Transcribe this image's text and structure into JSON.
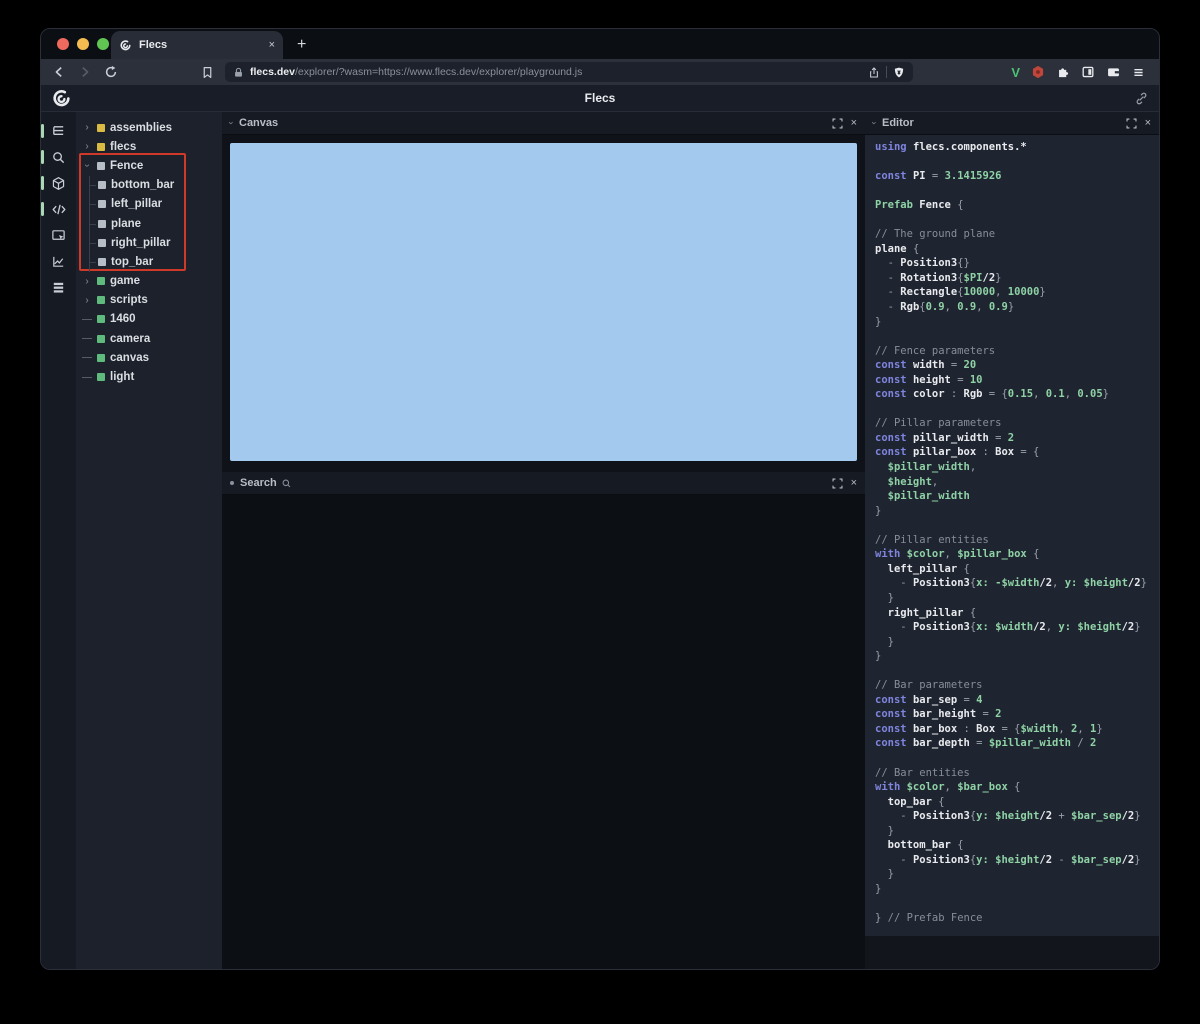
{
  "browser": {
    "tab_title": "Flecs",
    "new_tab_label": "+",
    "close_tab_label": "×",
    "url_domain": "flecs.dev",
    "url_path": "/explorer/?wasm=https://www.flecs.dev/explorer/playground.js",
    "traffic_colors": {
      "close": "#ee6a5f",
      "minimize": "#f5bd4f",
      "zoom": "#61c554"
    },
    "extension_v_label": "V"
  },
  "header": {
    "title": "Flecs"
  },
  "panels": {
    "canvas": {
      "title": "Canvas",
      "close_label": "×",
      "background_color": "#a3c9ee"
    },
    "search": {
      "title": "Search",
      "close_label": "×"
    },
    "editor": {
      "title": "Editor",
      "close_label": "×"
    }
  },
  "sidebar": {
    "items": [
      {
        "name": "entity-tree",
        "active": true
      },
      {
        "name": "query-search",
        "active": true
      },
      {
        "name": "canvas-3d",
        "active": true
      },
      {
        "name": "script-editor",
        "active": true
      },
      {
        "name": "inspector",
        "active": false
      },
      {
        "name": "statistics",
        "active": false
      },
      {
        "name": "logs",
        "active": false
      }
    ],
    "active_color": "#a9d9b4"
  },
  "tree": {
    "highlight_color": "#cf3a28",
    "icon_colors": {
      "yellow": "#d9bb43",
      "white": "#b8bec6",
      "green": "#5fba7d"
    },
    "items": [
      {
        "label": "assemblies",
        "icon": "yellow",
        "arrow": "collapsed",
        "child": false
      },
      {
        "label": "flecs",
        "icon": "yellow",
        "arrow": "collapsed",
        "child": false
      },
      {
        "label": "Fence",
        "icon": "white",
        "arrow": "expanded",
        "child": false
      },
      {
        "label": "bottom_bar",
        "icon": "white",
        "arrow": "none",
        "child": true
      },
      {
        "label": "left_pillar",
        "icon": "white",
        "arrow": "none",
        "child": true
      },
      {
        "label": "plane",
        "icon": "white",
        "arrow": "none",
        "child": true
      },
      {
        "label": "right_pillar",
        "icon": "white",
        "arrow": "none",
        "child": true
      },
      {
        "label": "top_bar",
        "icon": "white",
        "arrow": "none",
        "child": true
      },
      {
        "label": "game",
        "icon": "green",
        "arrow": "collapsed",
        "child": false
      },
      {
        "label": "scripts",
        "icon": "green",
        "arrow": "collapsed",
        "child": false
      },
      {
        "label": "1460",
        "icon": "green",
        "arrow": "leaf",
        "child": false
      },
      {
        "label": "camera",
        "icon": "green",
        "arrow": "leaf",
        "child": false
      },
      {
        "label": "canvas",
        "icon": "green",
        "arrow": "leaf",
        "child": false
      },
      {
        "label": "light",
        "icon": "green",
        "arrow": "leaf",
        "child": false
      }
    ]
  },
  "editor_code": {
    "token_colors": {
      "keyword": "#7e84de",
      "comment": "#878d99",
      "identifier": "#e8eaee",
      "value": "#8fd2a6",
      "punct": "#9aa1ab"
    },
    "lines": [
      [
        [
          "k",
          "using "
        ],
        [
          "i",
          "flecs.components.*"
        ]
      ],
      [],
      [
        [
          "k",
          "const "
        ],
        [
          "i",
          "PI"
        ],
        [
          "p",
          " = "
        ],
        [
          "g",
          "3.1415926"
        ]
      ],
      [],
      [
        [
          "g",
          "Prefab "
        ],
        [
          "i",
          "Fence "
        ],
        [
          "p",
          "{"
        ]
      ],
      [],
      [
        [
          "c",
          "// The ground plane"
        ]
      ],
      [
        [
          "i",
          "plane "
        ],
        [
          "p",
          "{"
        ]
      ],
      [
        [
          "p",
          "  - "
        ],
        [
          "i",
          "Position3"
        ],
        [
          "p",
          "{}"
        ]
      ],
      [
        [
          "p",
          "  - "
        ],
        [
          "i",
          "Rotation3"
        ],
        [
          "p",
          "{"
        ],
        [
          "g",
          "$PI"
        ],
        [
          "i",
          "/2"
        ],
        [
          "p",
          "}"
        ]
      ],
      [
        [
          "p",
          "  - "
        ],
        [
          "i",
          "Rectangle"
        ],
        [
          "p",
          "{"
        ],
        [
          "g",
          "10000"
        ],
        [
          "p",
          ", "
        ],
        [
          "g",
          "10000"
        ],
        [
          "p",
          "}"
        ]
      ],
      [
        [
          "p",
          "  - "
        ],
        [
          "i",
          "Rgb"
        ],
        [
          "p",
          "{"
        ],
        [
          "g",
          "0.9"
        ],
        [
          "p",
          ", "
        ],
        [
          "g",
          "0.9"
        ],
        [
          "p",
          ", "
        ],
        [
          "g",
          "0.9"
        ],
        [
          "p",
          "}"
        ]
      ],
      [
        [
          "p",
          "}"
        ]
      ],
      [],
      [
        [
          "c",
          "// Fence parameters"
        ]
      ],
      [
        [
          "k",
          "const "
        ],
        [
          "i",
          "width"
        ],
        [
          "p",
          " = "
        ],
        [
          "g",
          "20"
        ]
      ],
      [
        [
          "k",
          "const "
        ],
        [
          "i",
          "height"
        ],
        [
          "p",
          " = "
        ],
        [
          "g",
          "10"
        ]
      ],
      [
        [
          "k",
          "const "
        ],
        [
          "i",
          "color"
        ],
        [
          "p",
          " : "
        ],
        [
          "i",
          "Rgb"
        ],
        [
          "p",
          " = {"
        ],
        [
          "g",
          "0.15"
        ],
        [
          "p",
          ", "
        ],
        [
          "g",
          "0.1"
        ],
        [
          "p",
          ", "
        ],
        [
          "g",
          "0.05"
        ],
        [
          "p",
          "}"
        ]
      ],
      [],
      [
        [
          "c",
          "// Pillar parameters"
        ]
      ],
      [
        [
          "k",
          "const "
        ],
        [
          "i",
          "pillar_width"
        ],
        [
          "p",
          " = "
        ],
        [
          "g",
          "2"
        ]
      ],
      [
        [
          "k",
          "const "
        ],
        [
          "i",
          "pillar_box"
        ],
        [
          "p",
          " : "
        ],
        [
          "i",
          "Box"
        ],
        [
          "p",
          " = {"
        ]
      ],
      [
        [
          "g",
          "  $pillar_width"
        ],
        [
          "p",
          ","
        ]
      ],
      [
        [
          "g",
          "  $height"
        ],
        [
          "p",
          ","
        ]
      ],
      [
        [
          "g",
          "  $pillar_width"
        ]
      ],
      [
        [
          "p",
          "}"
        ]
      ],
      [],
      [
        [
          "c",
          "// Pillar entities"
        ]
      ],
      [
        [
          "k",
          "with "
        ],
        [
          "g",
          "$color"
        ],
        [
          "p",
          ", "
        ],
        [
          "g",
          "$pillar_box"
        ],
        [
          "p",
          " {"
        ]
      ],
      [
        [
          "i",
          "  left_pillar "
        ],
        [
          "p",
          "{"
        ]
      ],
      [
        [
          "p",
          "    - "
        ],
        [
          "i",
          "Position3"
        ],
        [
          "p",
          "{"
        ],
        [
          "g",
          "x: -$width"
        ],
        [
          "i",
          "/2"
        ],
        [
          "p",
          ", "
        ],
        [
          "g",
          "y: $height"
        ],
        [
          "i",
          "/2"
        ],
        [
          "p",
          "}"
        ]
      ],
      [
        [
          "p",
          "  }"
        ]
      ],
      [
        [
          "i",
          "  right_pillar "
        ],
        [
          "p",
          "{"
        ]
      ],
      [
        [
          "p",
          "    - "
        ],
        [
          "i",
          "Position3"
        ],
        [
          "p",
          "{"
        ],
        [
          "g",
          "x: $width"
        ],
        [
          "i",
          "/2"
        ],
        [
          "p",
          ", "
        ],
        [
          "g",
          "y: $height"
        ],
        [
          "i",
          "/2"
        ],
        [
          "p",
          "}"
        ]
      ],
      [
        [
          "p",
          "  }"
        ]
      ],
      [
        [
          "p",
          "}"
        ]
      ],
      [],
      [
        [
          "c",
          "// Bar parameters"
        ]
      ],
      [
        [
          "k",
          "const "
        ],
        [
          "i",
          "bar_sep"
        ],
        [
          "p",
          " = "
        ],
        [
          "g",
          "4"
        ]
      ],
      [
        [
          "k",
          "const "
        ],
        [
          "i",
          "bar_height"
        ],
        [
          "p",
          " = "
        ],
        [
          "g",
          "2"
        ]
      ],
      [
        [
          "k",
          "const "
        ],
        [
          "i",
          "bar_box"
        ],
        [
          "p",
          " : "
        ],
        [
          "i",
          "Box"
        ],
        [
          "p",
          " = {"
        ],
        [
          "g",
          "$width"
        ],
        [
          "p",
          ", "
        ],
        [
          "g",
          "2"
        ],
        [
          "p",
          ", "
        ],
        [
          "g",
          "1"
        ],
        [
          "p",
          "}"
        ]
      ],
      [
        [
          "k",
          "const "
        ],
        [
          "i",
          "bar_depth"
        ],
        [
          "p",
          " = "
        ],
        [
          "g",
          "$pillar_width"
        ],
        [
          "p",
          " / "
        ],
        [
          "g",
          "2"
        ]
      ],
      [],
      [
        [
          "c",
          "// Bar entities"
        ]
      ],
      [
        [
          "k",
          "with "
        ],
        [
          "g",
          "$color"
        ],
        [
          "p",
          ", "
        ],
        [
          "g",
          "$bar_box"
        ],
        [
          "p",
          " {"
        ]
      ],
      [
        [
          "i",
          "  top_bar "
        ],
        [
          "p",
          "{"
        ]
      ],
      [
        [
          "p",
          "    - "
        ],
        [
          "i",
          "Position3"
        ],
        [
          "p",
          "{"
        ],
        [
          "g",
          "y: $height"
        ],
        [
          "i",
          "/2"
        ],
        [
          "p",
          " + "
        ],
        [
          "g",
          "$bar_sep"
        ],
        [
          "i",
          "/2"
        ],
        [
          "p",
          "}"
        ]
      ],
      [
        [
          "p",
          "  }"
        ]
      ],
      [
        [
          "i",
          "  bottom_bar "
        ],
        [
          "p",
          "{"
        ]
      ],
      [
        [
          "p",
          "    - "
        ],
        [
          "i",
          "Position3"
        ],
        [
          "p",
          "{"
        ],
        [
          "g",
          "y: $height"
        ],
        [
          "i",
          "/2"
        ],
        [
          "p",
          " - "
        ],
        [
          "g",
          "$bar_sep"
        ],
        [
          "i",
          "/2"
        ],
        [
          "p",
          "}"
        ]
      ],
      [
        [
          "p",
          "  }"
        ]
      ],
      [
        [
          "p",
          "}"
        ]
      ],
      [],
      [
        [
          "p",
          "} "
        ],
        [
          "c",
          "// Prefab Fence"
        ]
      ]
    ]
  }
}
